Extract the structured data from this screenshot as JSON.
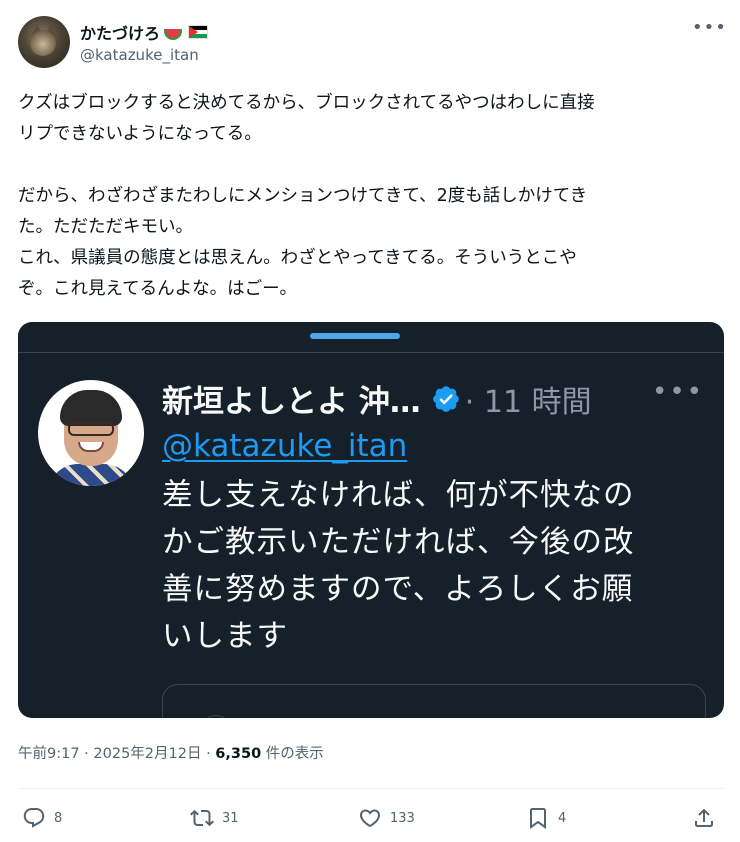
{
  "author": {
    "display_name": "かたづけろ",
    "handle": "@katazuke_itan",
    "emojis": [
      "watermelon-icon",
      "palestine-flag-icon"
    ]
  },
  "tweet": {
    "text": "クズはブロックすると決めてるから、ブロックされてるやつはわしに直接\nリプできないようになってる。\n\nだから、わざわざまたわしにメンションつけてきて、2度も話しかけてき\nた。ただただキモい。\nこれ、県議員の態度とは思えん。わざとやってきてる。そういうとこや\nぞ。これ見えてるんよな。はごー。"
  },
  "quoted_screenshot": {
    "name": "新垣よしとよ 沖…",
    "time": "· 11 時間",
    "mention": "@katazuke_itan",
    "body": "差し支えなければ、何が不快なの\nかご教示いただければ、今後の改\n善に努めますので、よろしくお願\nいします",
    "colors": {
      "background": "#15202b",
      "text": "#f7f9f9",
      "link": "#1d9bf0"
    }
  },
  "meta": {
    "datetime": "午前9:17 · 2025年2月12日 · ",
    "views_count": "6,350",
    "views_label": " 件の表示"
  },
  "actions": {
    "reply_count": "8",
    "repost_count": "31",
    "like_count": "133",
    "bookmark_count": "4"
  },
  "more_label": "•••"
}
